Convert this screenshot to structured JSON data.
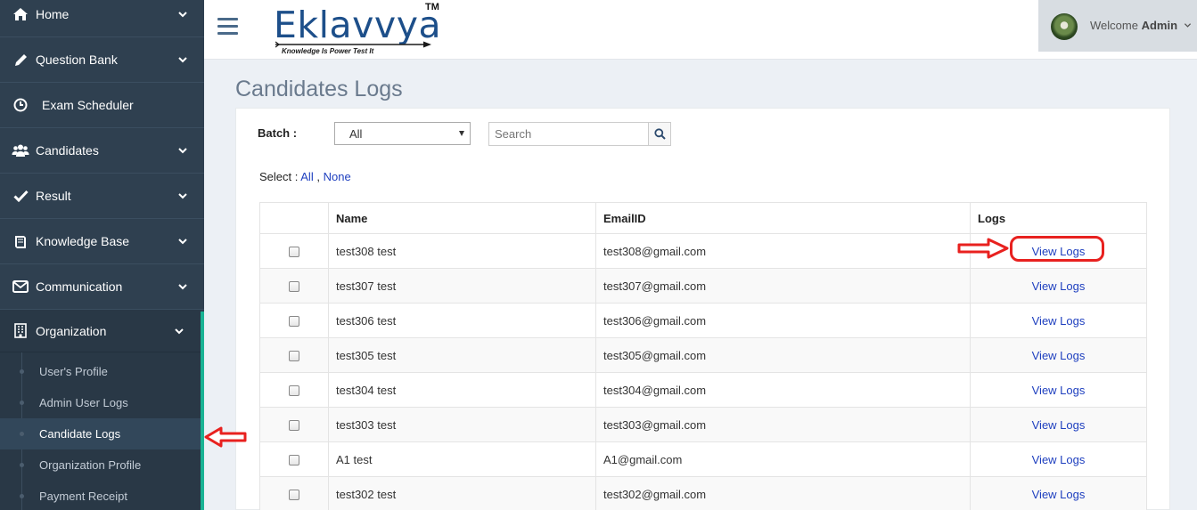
{
  "sidebar": {
    "items": [
      {
        "label": "Home",
        "icon": "home-icon"
      },
      {
        "label": "Question Bank",
        "icon": "pencil-icon"
      },
      {
        "label": "Exam Scheduler",
        "icon": "clock-icon"
      },
      {
        "label": "Candidates",
        "icon": "users-icon"
      },
      {
        "label": "Result",
        "icon": "check-icon"
      },
      {
        "label": "Knowledge Base",
        "icon": "book-icon"
      },
      {
        "label": "Communication",
        "icon": "envelope-icon"
      },
      {
        "label": "Organization",
        "icon": "building-icon"
      }
    ],
    "subitems": [
      {
        "label": "User's Profile"
      },
      {
        "label": "Admin User Logs"
      },
      {
        "label": "Candidate Logs"
      },
      {
        "label": "Organization Profile"
      },
      {
        "label": "Payment Receipt"
      }
    ],
    "active_subitem": "Candidate Logs"
  },
  "header": {
    "logo_text": "Eklavvya",
    "logo_tm": "TM",
    "logo_tagline": "Knowledge Is Power Test It",
    "welcome_prefix": "Welcome",
    "welcome_user": "Admin"
  },
  "page": {
    "title": "Candidates Logs",
    "batch_label": "Batch :",
    "batch_value": "All",
    "search_placeholder": "Search",
    "select_label": "Select :",
    "select_all": "All",
    "select_sep": ",",
    "select_none": "None"
  },
  "table": {
    "headers": {
      "name": "Name",
      "email": "EmailID",
      "logs": "Logs"
    },
    "rows": [
      {
        "name": "test308 test",
        "email": "test308@gmail.com",
        "logs": "View Logs"
      },
      {
        "name": "test307 test",
        "email": "test307@gmail.com",
        "logs": "View Logs"
      },
      {
        "name": "test306 test",
        "email": "test306@gmail.com",
        "logs": "View Logs"
      },
      {
        "name": "test305 test",
        "email": "test305@gmail.com",
        "logs": "View Logs"
      },
      {
        "name": "test304 test",
        "email": "test304@gmail.com",
        "logs": "View Logs"
      },
      {
        "name": "test303 test",
        "email": "test303@gmail.com",
        "logs": "View Logs"
      },
      {
        "name": "A1 test",
        "email": "A1@gmail.com",
        "logs": "View Logs"
      },
      {
        "name": "test302 test",
        "email": "test302@gmail.com",
        "logs": "View Logs"
      }
    ]
  },
  "colors": {
    "sidebar_bg": "#2f4050",
    "accent_green": "#1ab394",
    "link_blue": "#1e3fbf",
    "annotation_red": "#e8211f"
  }
}
